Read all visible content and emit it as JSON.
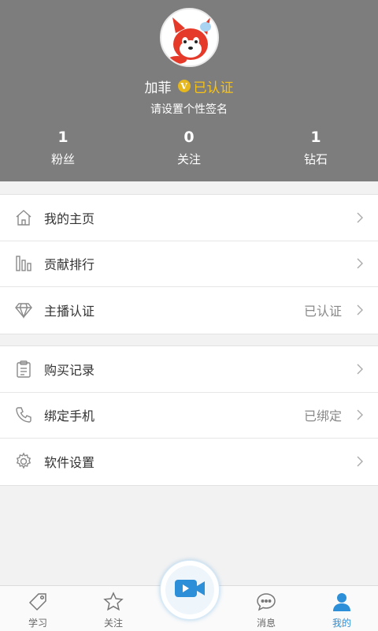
{
  "profile": {
    "name": "加菲",
    "badge_letter": "V",
    "verified_text": "已认证",
    "signature": "请设置个性签名"
  },
  "stats": [
    {
      "value": "1",
      "label": "粉丝"
    },
    {
      "value": "0",
      "label": "关注"
    },
    {
      "value": "1",
      "label": "钻石"
    }
  ],
  "menu_group_1": [
    {
      "label": "我的主页",
      "value": "",
      "icon": "home-icon"
    },
    {
      "label": "贡献排行",
      "value": "",
      "icon": "bar-ranking-icon"
    },
    {
      "label": "主播认证",
      "value": "已认证",
      "icon": "diamond-icon"
    }
  ],
  "menu_group_2": [
    {
      "label": "购买记录",
      "value": "",
      "icon": "clipboard-icon"
    },
    {
      "label": "绑定手机",
      "value": "已绑定",
      "icon": "phone-icon"
    },
    {
      "label": "软件设置",
      "value": "",
      "icon": "gear-icon"
    }
  ],
  "tabbar": {
    "tabs": [
      {
        "label": "学习",
        "icon": "tag-icon"
      },
      {
        "label": "关注",
        "icon": "star-icon"
      },
      {
        "label": "消息",
        "icon": "chat-bubble-icon"
      },
      {
        "label": "我的",
        "icon": "person-icon"
      }
    ],
    "active_tab": "我的",
    "center_icon": "video-camera-icon"
  },
  "colors": {
    "header_bg": "#7d7d7d",
    "verified_gold": "#f5c21b",
    "accent_blue": "#2d8fd8"
  }
}
